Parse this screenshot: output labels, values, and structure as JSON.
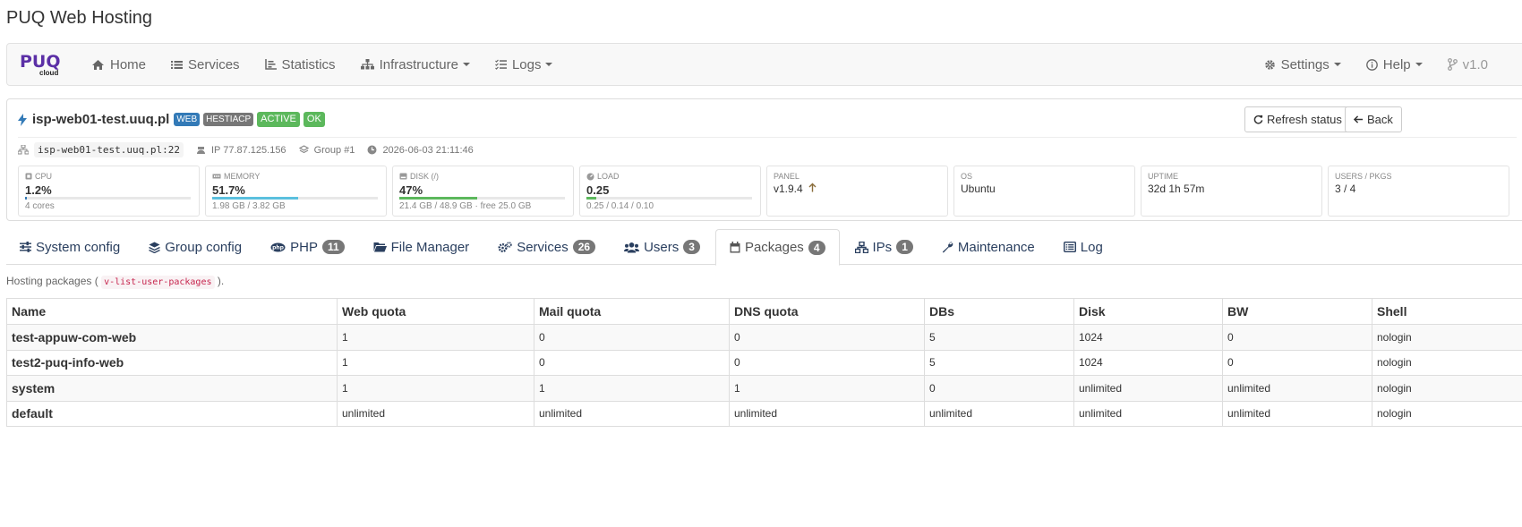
{
  "app_title": "PUQ Web Hosting",
  "brand": {
    "logo_text": "PUQ",
    "logo_sub": "cloud"
  },
  "nav": {
    "left": [
      {
        "label": "Home",
        "icon": "home-icon"
      },
      {
        "label": "Services",
        "icon": "list-icon"
      },
      {
        "label": "Statistics",
        "icon": "chart-icon"
      },
      {
        "label": "Infrastructure",
        "icon": "sitemap-icon",
        "dropdown": true
      },
      {
        "label": "Logs",
        "icon": "tasks-icon",
        "dropdown": true
      }
    ],
    "right": [
      {
        "label": "Settings",
        "icon": "gear-icon",
        "dropdown": true
      },
      {
        "label": "Help",
        "icon": "info-icon",
        "dropdown": true
      },
      {
        "label": "v1.0",
        "icon": "branch-icon"
      }
    ]
  },
  "server": {
    "name": "isp-web01-test.uuq.pl",
    "labels": [
      "WEB",
      "HESTIACP",
      "ACTIVE",
      "OK"
    ],
    "refresh_label": "Refresh status",
    "back_label": "Back",
    "host": "isp-web01-test.uuq.pl:22",
    "ip": "IP 77.87.125.156",
    "group": "Group #1",
    "timestamp": "2026-06-03 21:11:46"
  },
  "tiles": [
    {
      "label": "CPU",
      "value": "1.2%",
      "sub": "4 cores",
      "bar": 0.012,
      "color": "#337ab7"
    },
    {
      "label": "MEMORY",
      "value": "51.7%",
      "sub": "1.98 GB / 3.82 GB",
      "bar": 0.517,
      "color": "#5bc0de"
    },
    {
      "label": "DISK (/)",
      "value": "47%",
      "sub": "21.4 GB / 48.9 GB · free 25.0 GB",
      "bar": 0.47,
      "color": "#5cb85c"
    },
    {
      "label": "LOAD",
      "value": "0.25",
      "sub": "0.25 / 0.14 / 0.10",
      "bar": 0.06,
      "color": "#5cb85c"
    },
    {
      "label": "PANEL",
      "value": "v1.9.4",
      "sub": ""
    },
    {
      "label": "OS",
      "value": "Ubuntu",
      "sub": ""
    },
    {
      "label": "UPTIME",
      "value": "32d 1h 57m",
      "sub": ""
    },
    {
      "label": "USERS / PKGS",
      "value": "3 / 4",
      "sub": ""
    }
  ],
  "tabs": [
    {
      "label": "System config",
      "icon": "sliders-icon"
    },
    {
      "label": "Group config",
      "icon": "layers-icon"
    },
    {
      "label": "PHP",
      "icon": "php-icon",
      "badge": "11"
    },
    {
      "label": "File Manager",
      "icon": "folder-icon"
    },
    {
      "label": "Services",
      "icon": "cogs-icon",
      "badge": "26"
    },
    {
      "label": "Users",
      "icon": "users-icon",
      "badge": "3"
    },
    {
      "label": "Packages",
      "icon": "calendar-icon",
      "badge": "4",
      "active": true
    },
    {
      "label": "IPs",
      "icon": "network-icon",
      "badge": "1"
    },
    {
      "label": "Maintenance",
      "icon": "wrench-icon"
    },
    {
      "label": "Log",
      "icon": "list-alt-icon"
    }
  ],
  "note": {
    "prefix": "Hosting packages (",
    "code": "v-list-user-packages",
    "suffix": ")."
  },
  "table": {
    "headers": [
      "Name",
      "Web quota",
      "Mail quota",
      "DNS quota",
      "DBs",
      "Disk",
      "BW",
      "Shell"
    ],
    "rows": [
      [
        "test-appuw-com-web",
        "1",
        "0",
        "0",
        "5",
        "1024",
        "0",
        "nologin"
      ],
      [
        "test2-puq-info-web",
        "1",
        "0",
        "0",
        "5",
        "1024",
        "0",
        "nologin"
      ],
      [
        "system",
        "1",
        "1",
        "1",
        "0",
        "unlimited",
        "unlimited",
        "nologin"
      ],
      [
        "default",
        "unlimited",
        "unlimited",
        "unlimited",
        "unlimited",
        "unlimited",
        "unlimited",
        "nologin"
      ]
    ]
  }
}
